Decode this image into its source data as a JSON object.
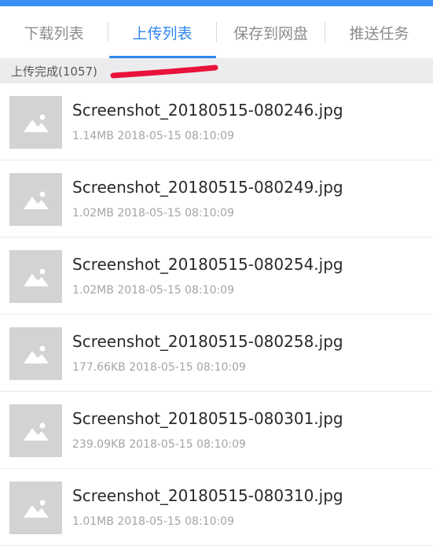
{
  "tabs": [
    {
      "label": "下载列表",
      "active": false
    },
    {
      "label": "上传列表",
      "active": true
    },
    {
      "label": "保存到网盘",
      "active": false
    },
    {
      "label": "推送任务",
      "active": false
    }
  ],
  "section": {
    "title": "上传完成(1057)"
  },
  "items": [
    {
      "filename": "Screenshot_20180515-080246.jpg",
      "size": "1.14MB",
      "time": "2018-05-15 08:10:09"
    },
    {
      "filename": "Screenshot_20180515-080249.jpg",
      "size": "1.02MB",
      "time": "2018-05-15 08:10:09"
    },
    {
      "filename": "Screenshot_20180515-080254.jpg",
      "size": "1.02MB",
      "time": "2018-05-15 08:10:09"
    },
    {
      "filename": "Screenshot_20180515-080258.jpg",
      "size": "177.66KB",
      "time": "2018-05-15 08:10:09"
    },
    {
      "filename": "Screenshot_20180515-080301.jpg",
      "size": "239.09KB",
      "time": "2018-05-15 08:10:09"
    },
    {
      "filename": "Screenshot_20180515-080310.jpg",
      "size": "1.01MB",
      "time": "2018-05-15 08:10:09"
    }
  ],
  "icons": {
    "thumbnail": "image-placeholder-icon"
  },
  "colors": {
    "accent": "#2f86ee",
    "top_bar": "#3b8ff2",
    "annotation": "#e8123a",
    "thumbnail_bg": "#d3d3d3"
  }
}
